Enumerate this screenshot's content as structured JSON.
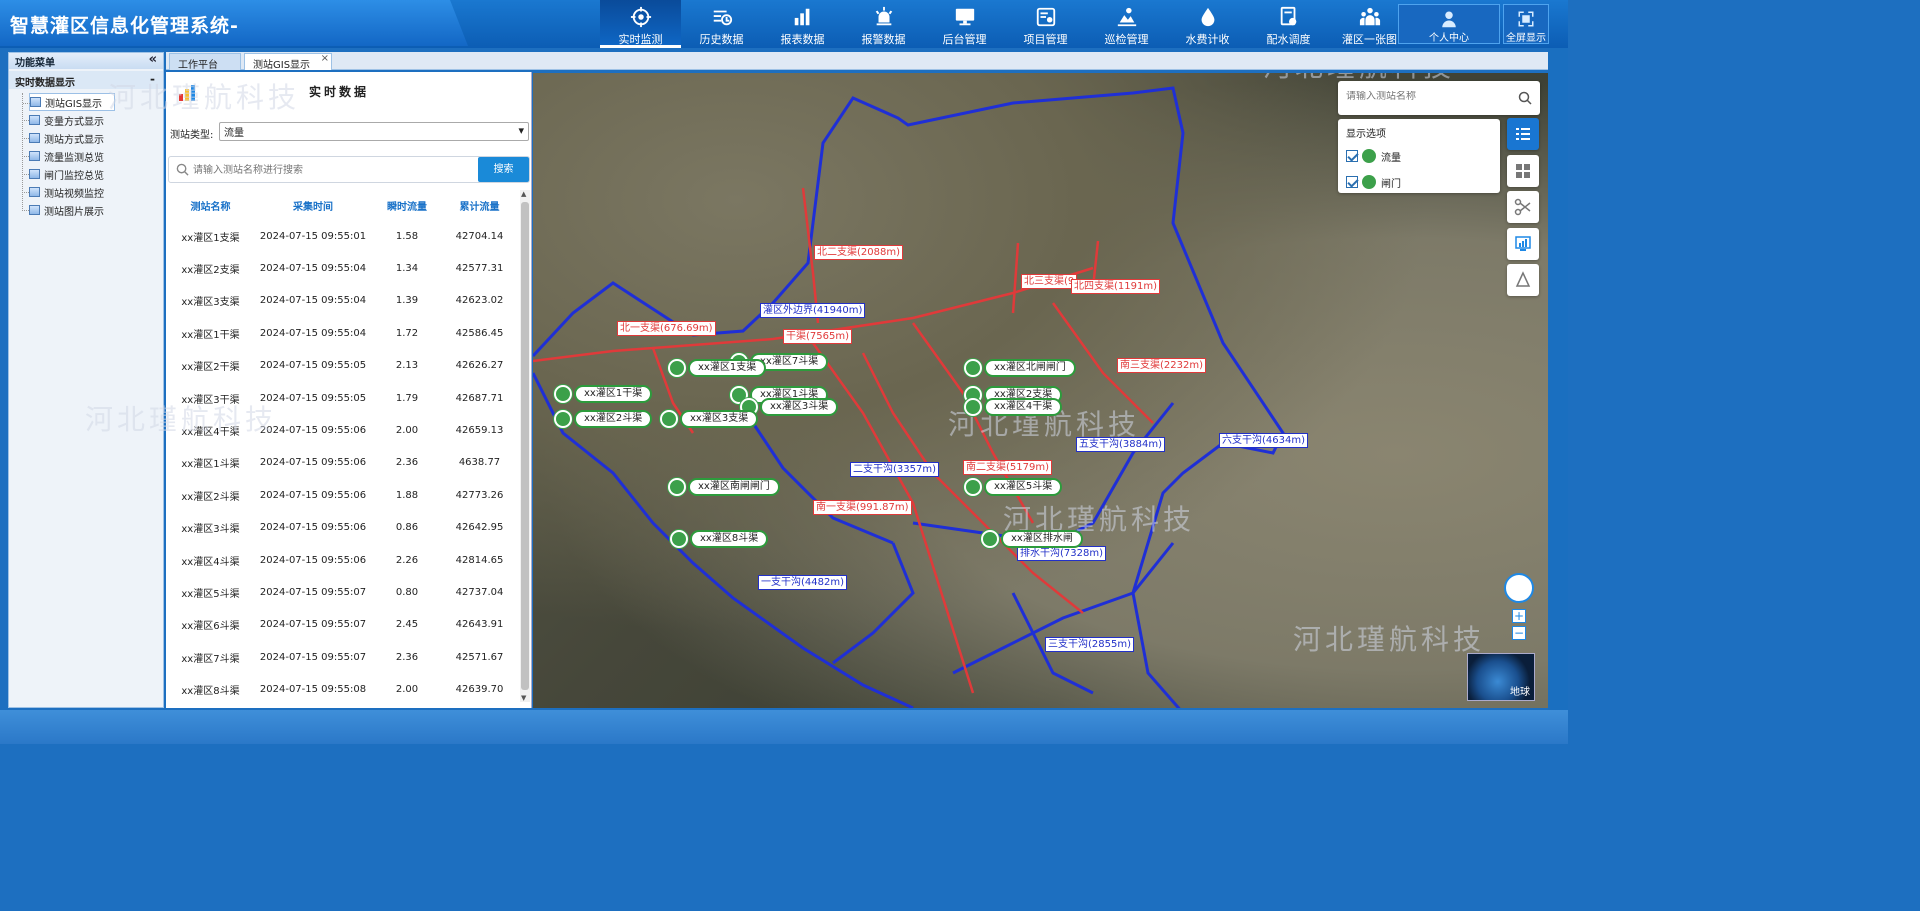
{
  "app": {
    "title": "智慧灌区信息化管理系统-"
  },
  "nav": [
    {
      "label": "实时监测",
      "icon": "target-icon",
      "active": true
    },
    {
      "label": "历史数据",
      "icon": "history-icon"
    },
    {
      "label": "报表数据",
      "icon": "bar-chart-icon"
    },
    {
      "label": "报警数据",
      "icon": "alarm-icon"
    },
    {
      "label": "后台管理",
      "icon": "monitor-icon"
    },
    {
      "label": "项目管理",
      "icon": "project-icon"
    },
    {
      "label": "巡检管理",
      "icon": "inspect-icon"
    },
    {
      "label": "水费计收",
      "icon": "water-drop-icon"
    },
    {
      "label": "配水调度",
      "icon": "dispatch-icon"
    },
    {
      "label": "灌区一张图",
      "icon": "people-icon"
    }
  ],
  "header_right": {
    "user_center": "个人中心",
    "fullscreen": "全屏显示"
  },
  "sidebar": {
    "title": "功能菜单",
    "collapse": "«",
    "group": "实时数据显示",
    "group_toggle": "-",
    "items": [
      "测站GIS显示",
      "变量方式显示",
      "测站方式显示",
      "流量监测总览",
      "闸门监控总览",
      "测站视频监控",
      "测站图片展示"
    ]
  },
  "tabs": [
    {
      "label": "工作平台"
    },
    {
      "label": "测站GIS显示",
      "close": "×"
    }
  ],
  "panel": {
    "title": "实时数据",
    "type_label": "测站类型:",
    "type_value": "流量",
    "search_placeholder": "请输入测站名称进行搜索",
    "search_button": "搜索",
    "columns": [
      "测站名称",
      "采集时间",
      "瞬时流量",
      "累计流量"
    ],
    "rows": [
      [
        "xx灌区1支渠",
        "2024-07-15 09:55:01",
        "1.58",
        "42704.14"
      ],
      [
        "xx灌区2支渠",
        "2024-07-15 09:55:04",
        "1.34",
        "42577.31"
      ],
      [
        "xx灌区3支渠",
        "2024-07-15 09:55:04",
        "1.39",
        "42623.02"
      ],
      [
        "xx灌区1干渠",
        "2024-07-15 09:55:04",
        "1.72",
        "42586.45"
      ],
      [
        "xx灌区2干渠",
        "2024-07-15 09:55:05",
        "2.13",
        "42626.27"
      ],
      [
        "xx灌区3干渠",
        "2024-07-15 09:55:05",
        "1.79",
        "42687.71"
      ],
      [
        "xx灌区4干渠",
        "2024-07-15 09:55:06",
        "2.00",
        "42659.13"
      ],
      [
        "xx灌区1斗渠",
        "2024-07-15 09:55:06",
        "2.36",
        "4638.77"
      ],
      [
        "xx灌区2斗渠",
        "2024-07-15 09:55:06",
        "1.88",
        "42773.26"
      ],
      [
        "xx灌区3斗渠",
        "2024-07-15 09:55:06",
        "0.86",
        "42642.95"
      ],
      [
        "xx灌区4斗渠",
        "2024-07-15 09:55:06",
        "2.26",
        "42814.65"
      ],
      [
        "xx灌区5斗渠",
        "2024-07-15 09:55:07",
        "0.80",
        "42737.04"
      ],
      [
        "xx灌区6斗渠",
        "2024-07-15 09:55:07",
        "2.45",
        "42643.91"
      ],
      [
        "xx灌区7斗渠",
        "2024-07-15 09:55:07",
        "2.36",
        "42571.67"
      ],
      [
        "xx灌区8斗渠",
        "2024-07-15 09:55:08",
        "2.00",
        "42639.70"
      ]
    ]
  },
  "map": {
    "search_placeholder": "请输入测站名称",
    "display_title": "显示选项",
    "options": [
      "流量",
      "闸门"
    ],
    "earth_label": "地球",
    "zoom_in": "+",
    "zoom_out": "−",
    "watermark": "河北瑾航科技",
    "red_labels": [
      "北二支渠(2088m)",
      "北三支渠(9",
      "北四支渠(1191m)",
      "北一支渠(676.69m)",
      "干渠(7565m)",
      "南三支渠(2232m)",
      "南二支渠(5179m)",
      "南一支渠(991.87m)"
    ],
    "blue_labels": [
      "灌区外边界(41940m)",
      "五支干沟(3884m)",
      "六支干沟(4634m)",
      "二支干沟(3357m)",
      "排水干沟(7328m)",
      "一支干沟(4482m)",
      "三支干沟(2855m)"
    ],
    "stations": [
      "xx灌区7斗渠",
      "xx灌区1支渠",
      "xx灌区北闸闸门",
      "xx灌区1干渠",
      "xx灌区1斗渠",
      "xx灌区2支渠",
      "xx灌区3斗渠",
      "xx灌区4干渠",
      "xx灌区2斗渠",
      "xx灌区3支渠",
      "xx灌区南闸闸门",
      "xx灌区5斗渠",
      "xx灌区8斗渠",
      "xx灌区排水闸"
    ]
  },
  "colors": {
    "header": "#0c5db4",
    "accent": "#1a8ad8",
    "canal_red": "#e03a3a",
    "ditch_blue": "#1f2fd6",
    "station_green": "#3ca04a"
  }
}
